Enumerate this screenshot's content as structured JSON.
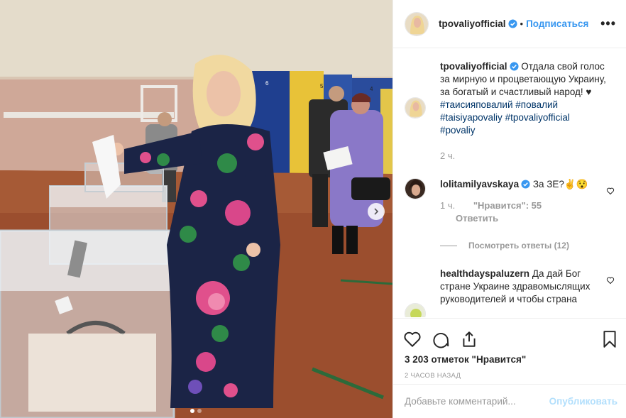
{
  "photo": {
    "description_icon": "photo",
    "box_numbers": [
      "6",
      "5",
      "4"
    ]
  },
  "post": {
    "author": "tpovaliyofficial",
    "separator": "•",
    "follow_label": "Подписаться",
    "more_label": "•••",
    "caption": "Отдала свой голос за мирную и процветающую Украину, за богатый и счастливый народ! ♥",
    "hashtags": [
      "#таисияповалий",
      "#повалий",
      "#taisiyapovaliy",
      "#tpovaliyofficial",
      "#povaliy"
    ],
    "caption_time": "2 ч."
  },
  "comments": [
    {
      "user": "lolitamilyavskaya",
      "text": "За ЗЕ?✌️😯",
      "time": "1 ч.",
      "likes": "\"Нравится\": 55",
      "reply_label": "Ответить",
      "view_replies": "Посмотреть ответы (12)"
    },
    {
      "user": "healthdayspaluzern",
      "text": "Да дай Бог стране Украине здравомыслящих руководителей и чтобы страна"
    }
  ],
  "actions": {
    "likes_text": "3 203 отметок \"Нравится\"",
    "timestamp": "2 ЧАСОВ НАЗАД"
  },
  "add_comment": {
    "placeholder": "Добавьте комментарий...",
    "publish_label": "Опубликовать"
  },
  "colors": {
    "accent": "#3897f0",
    "publish_disabled": "#b2dffc",
    "secondary_text": "#999999",
    "hashtag": "#003569"
  }
}
